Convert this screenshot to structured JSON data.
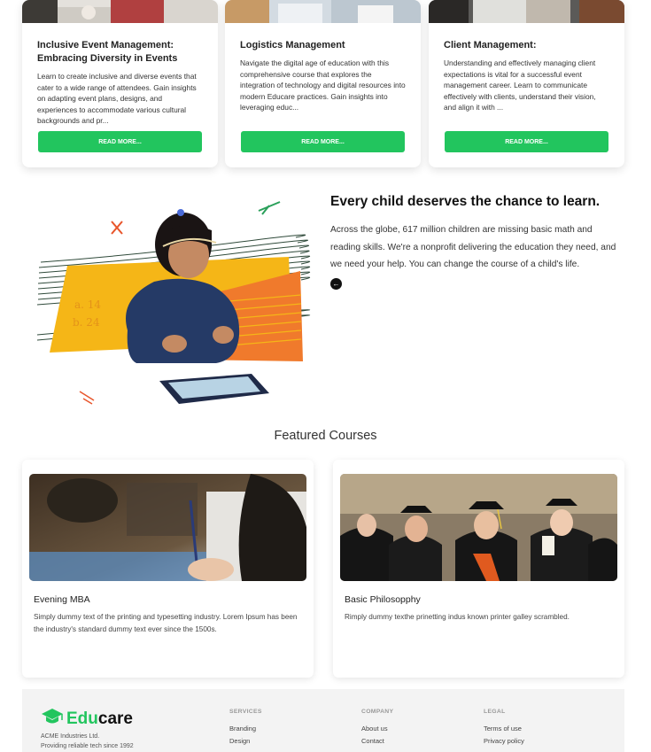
{
  "top_cards": [
    {
      "title": "Inclusive Event Management: Embracing Diversity in Events",
      "text": "Learn to create inclusive and diverse events that cater to a wide range of attendees. Gain insights on adapting event plans, designs, and experiences to accommodate various cultural backgrounds and pr...",
      "button": "READ MORE..."
    },
    {
      "title": "Logistics Management",
      "text": "Navigate the digital age of education with this comprehensive course that explores the integration of technology and digital resources into modern Educare practices. Gain insights into leveraging educ...",
      "button": "READ MORE..."
    },
    {
      "title": "Client Management:",
      "text": "Understanding and effectively managing client expectations is vital for a successful event management career. Learn to communicate effectively with clients, understand their vision, and align it with ...",
      "button": "READ MORE..."
    }
  ],
  "hero": {
    "title": "Every child deserves the chance to learn.",
    "text": "Across the globe, 617 million children are missing basic math and reading skills. We're a nonprofit delivering the education they need, and we need your help. You can change the course of a child's life.",
    "arrow_icon": "arrow-left-icon"
  },
  "featured": {
    "heading": "Featured Courses",
    "courses": [
      {
        "title": "Evening MBA",
        "text": "Simply dummy text of the printing and typesetting industry. Lorem Ipsum has been the industry's standard dummy text ever since the 1500s."
      },
      {
        "title": "Basic Philosopphy",
        "text": "Rimply dummy texthe prinetting indus known printer galley scrambled."
      }
    ]
  },
  "footer": {
    "brand_prefix": "Edu",
    "brand_suffix": "care",
    "company": "ACME Industries Ltd.",
    "tagline": "Providing reliable tech since 1992",
    "columns": [
      {
        "heading": "SERVICES",
        "links": [
          "Branding",
          "Design"
        ]
      },
      {
        "heading": "COMPANY",
        "links": [
          "About us",
          "Contact"
        ]
      },
      {
        "heading": "LEGAL",
        "links": [
          "Terms of use",
          "Privacy policy"
        ]
      }
    ]
  },
  "colors": {
    "accent": "#22c55e",
    "text_dark": "#111111",
    "footer_bg": "#f3f3f3"
  }
}
